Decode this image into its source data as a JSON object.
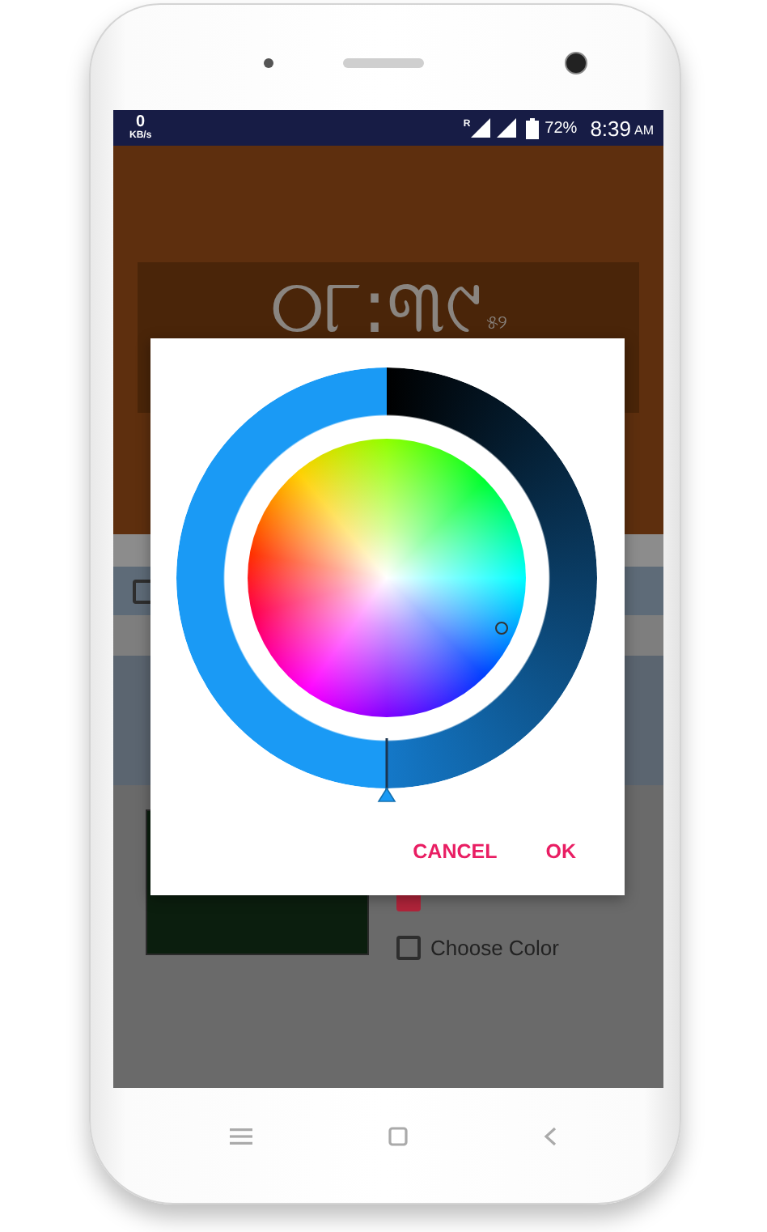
{
  "status_bar": {
    "speed": "0",
    "speed_unit": "KB/s",
    "roaming": "R",
    "battery": "72%",
    "time": "8:39",
    "meridiem": "AM"
  },
  "clock": {
    "time": "୦୮:୩୯",
    "seconds": "୫୨"
  },
  "row_checkbox": {
    "checked": false
  },
  "options": [
    {
      "checked": true
    },
    {
      "checked": false,
      "label": "Choose Color"
    }
  ],
  "color_dialog": {
    "ring": {
      "level": 0.5
    },
    "buttons": [
      "CANCEL",
      "OK"
    ]
  }
}
